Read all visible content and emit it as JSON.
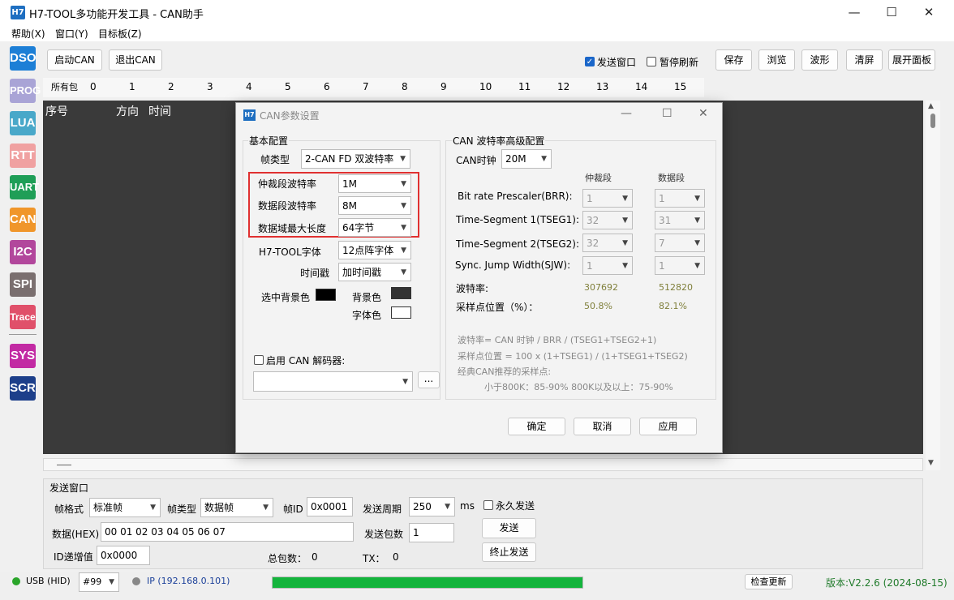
{
  "window": {
    "icon_text": "H7",
    "title": "H7-TOOL多功能开发工具 - CAN助手",
    "min": "—",
    "max": "☐",
    "close": "✕"
  },
  "menu": [
    "帮助(X)",
    "窗口(Y)",
    "目标板(Z)"
  ],
  "sidebar": [
    {
      "label": "DSO",
      "color": "#1d7fd6"
    },
    {
      "label": "PROG",
      "color": "#a9a4d6"
    },
    {
      "label": "LUA",
      "color": "#49a8c9"
    },
    {
      "label": "RTT",
      "color": "#f0a1a1"
    },
    {
      "label": "UART",
      "color": "#1f9e57"
    },
    {
      "label": "CAN",
      "color": "#f0962a"
    },
    {
      "label": "I2C",
      "color": "#b2479c"
    },
    {
      "label": "SPI",
      "color": "#7a6f6f"
    },
    {
      "label": "Trace",
      "color": "#e0506a"
    },
    {
      "label": "SYS",
      "color": "#c22aa3"
    },
    {
      "label": "SCR",
      "color": "#1d3f8a"
    }
  ],
  "toolbar": {
    "start_can": "启动CAN",
    "exit_can": "退出CAN",
    "send_window": "发送窗口",
    "pause_refresh": "暂停刷新",
    "save": "保存",
    "browse": "浏览",
    "wave": "波形",
    "clear": "清屏",
    "expand": "展开面板"
  },
  "tabs": [
    "所有包",
    "0",
    "1",
    "2",
    "3",
    "4",
    "5",
    "6",
    "7",
    "8",
    "9",
    "10",
    "11",
    "12",
    "13",
    "14",
    "15"
  ],
  "grid_headers": {
    "seq": "序号",
    "dir": "方向",
    "time": "时间"
  },
  "send_panel": {
    "title": "发送窗口",
    "frame_format_label": "帧格式",
    "frame_format": "标准帧",
    "frame_type_label": "帧类型",
    "frame_type": "数据帧",
    "frame_id_label": "帧ID",
    "frame_id": "0x0001",
    "period_label": "发送周期",
    "period": "250",
    "period_unit": "ms",
    "forever_label": "永久发送",
    "data_label": "数据(HEX)",
    "data": "00 01 02 03 04 05 06 07",
    "count_label": "发送包数",
    "count": "1",
    "send": "发送",
    "stop_send": "终止发送",
    "id_inc_label": "ID递增值",
    "id_inc": "0x0000",
    "total_label": "总包数：",
    "total": "0",
    "tx_label": "TX：",
    "tx": "0"
  },
  "status": {
    "usb": "USB (HID)",
    "device": "#99",
    "ip": "IP (192.168.0.101)",
    "progress": 1.0,
    "check_update": "检查更新",
    "version": "版本:V2.2.6 (2024-08-15)"
  },
  "dialog": {
    "icon_text": "H7",
    "title": "CAN参数设置",
    "basic_group": "基本配置",
    "frame_type_label": "帧类型",
    "frame_type": "2-CAN FD 双波特率",
    "arb_rate_label": "仲裁段波特率",
    "arb_rate": "1M",
    "data_rate_label": "数据段波特率",
    "data_rate": "8M",
    "max_len_label": "数据域最大长度",
    "max_len": "64字节",
    "font_label": "H7-TOOL字体",
    "font": "12点阵字体",
    "timestamp_label": "时间戳",
    "timestamp": "加时间戳",
    "sel_bg_label": "选中背景色",
    "bg_label": "背景色",
    "fg_label": "字体色",
    "decoder_label": "启用 CAN 解码器:",
    "decoder_value": "",
    "browse_btn": "...",
    "adv_group": "CAN 波特率高级配置",
    "can_clock_label": "CAN时钟",
    "can_clock": "20M",
    "col_arb": "仲裁段",
    "col_data": "数据段",
    "brp_label": "Bit rate  Prescaler(BRR):",
    "brp_arb": "1",
    "brp_data": "1",
    "tseg1_label": "Time-Segment 1(TSEG1):",
    "tseg1_arb": "32",
    "tseg1_data": "31",
    "tseg2_label": "Time-Segment 2(TSEG2):",
    "tseg2_arb": "32",
    "tseg2_data": "7",
    "sjw_label": "Sync. Jump Width(SJW):",
    "sjw_arb": "1",
    "sjw_data": "1",
    "baud_label": "波特率:",
    "baud_arb": "307692",
    "baud_data": "512820",
    "sample_label": "采样点位置（%）：",
    "sample_arb": "50.8%",
    "sample_data": "82.1%",
    "note1": "波特率= CAN 时钟 / BRR / (TSEG1+TSEG2+1)",
    "note2": "采样点位置 = 100 x (1+TSEG1) / (1+TSEG1+TSEG2)",
    "note3": "经典CAN推荐的采样点:",
    "note4": "小于800K：85-90%    800K以及以上：75-90%",
    "ok": "确定",
    "cancel": "取消",
    "apply": "应用",
    "colors": {
      "sel_bg": "#000000",
      "bg": "#333333",
      "fg": "#ffffff",
      "highlight": "#e03030"
    }
  }
}
